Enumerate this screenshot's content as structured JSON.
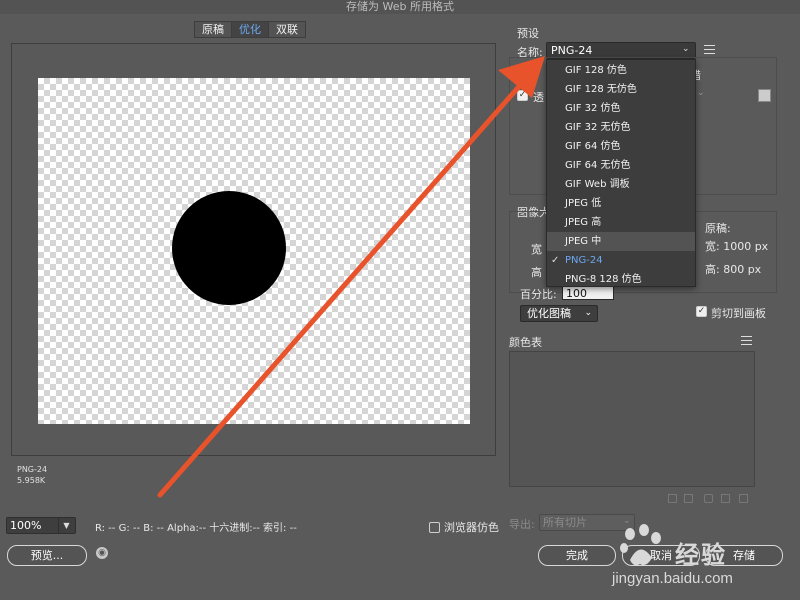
{
  "window": {
    "title": "存储为 Web 所用格式"
  },
  "tabs": [
    "原稿",
    "优化",
    "双联"
  ],
  "preview": {
    "format": "PNG-24",
    "size": "5.958K"
  },
  "bottom": {
    "zoom": "100%",
    "pixel_info": "R: -- G: -- B: -- Alpha:-- 十六进制:-- 索引: --",
    "browser_dither": "浏览器仿色",
    "preview_button": "预览...",
    "done_button": "完成",
    "cancel_button": "取消",
    "save_button": "存储"
  },
  "preset": {
    "title": "预设",
    "name_label": "名称:",
    "name_value": "PNG-24",
    "options": [
      "GIF 128 仿色",
      "GIF 128 无仿色",
      "GIF 32 仿色",
      "GIF 32 无仿色",
      "GIF 64 仿色",
      "GIF 64 无仿色",
      "GIF Web 调板",
      "JPEG 低",
      "JPEG 高",
      "JPEG 中",
      "PNG-24",
      "PNG-8 128 仿色"
    ],
    "hidden_frag_left": "透",
    "hidden_frag_right": "错"
  },
  "image_size": {
    "label": "图像大",
    "w_frag": "宽",
    "h_frag": "高",
    "original_label": "原稿:",
    "original_w": "宽: 1000 px",
    "original_h": "高: 800 px",
    "percent_label": "百分比:",
    "percent_value": "100",
    "quality_select": "优化图稿",
    "clip_label": "剪切到画板"
  },
  "color_table": {
    "label": "颜色表"
  },
  "export": {
    "label": "导出:",
    "value": "所有切片"
  },
  "watermark": {
    "brand": "经验",
    "url": "jingyan.baidu.com"
  },
  "colors": {
    "accent": "#6ba7f0",
    "arrow": "#e8532b"
  }
}
